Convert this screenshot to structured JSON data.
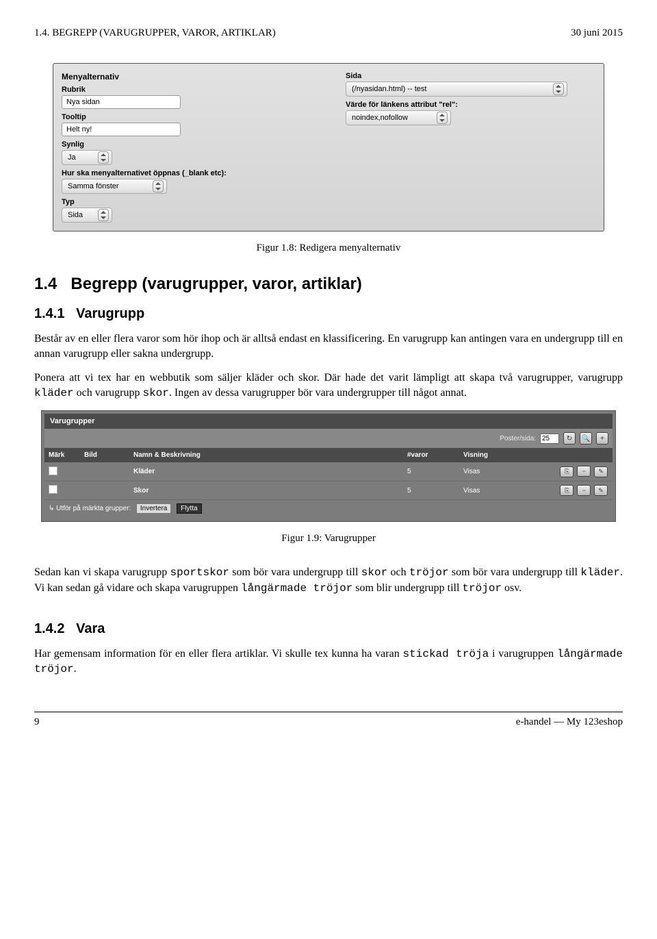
{
  "header": {
    "left": "1.4. BEGREPP (VARUGRUPPER, VAROR, ARTIKLAR)",
    "right": "30 juni 2015"
  },
  "fig1": {
    "title": "Menyalternativ",
    "labels": {
      "rubrik": "Rubrik",
      "tooltip": "Tooltip",
      "synlig": "Synlig",
      "open": "Hur ska menyalternativet öppnas (_blank etc):",
      "typ": "Typ",
      "sida": "Sida",
      "rel": "Värde för länkens attribut \"rel\":"
    },
    "values": {
      "rubrik": "Nya sidan",
      "tooltip": "Helt ny!",
      "synlig": "Ja",
      "open": "Samma fönster",
      "typ": "Sida",
      "sida": "(/nyasidan.html) -- test",
      "rel": "noindex,nofollow"
    },
    "caption": "Figur 1.8: Redigera menyalternativ"
  },
  "sec14": {
    "num": "1.4",
    "title": "Begrepp (varugrupper, varor, artiklar)"
  },
  "sec141": {
    "num": "1.4.1",
    "title": "Varugrupp",
    "p1a": "Består av en eller flera varor som hör ihop och är alltså endast en klassificering. En varugrupp kan antingen vara en undergrupp till en annan varugrupp eller sakna undergrupp.",
    "p2a": "Ponera att vi tex har en webbutik som säljer kläder och skor. Där hade det varit lämpligt att skapa två varugrupper, varugrupp ",
    "p2b": " och varugrupp ",
    "p2c": ". Ingen av dessa varugrupper bör vara undergrupper till något annat.",
    "tt_klader": "kläder",
    "tt_skor": "skor"
  },
  "fig2": {
    "title": "Varugrupper",
    "poster_label": "Poster/sida:",
    "poster_value": "25",
    "cols": {
      "mark": "Märk",
      "bild": "Bild",
      "namn": "Namn & Beskrivning",
      "varor": "#varor",
      "visning": "Visning"
    },
    "rows": [
      {
        "namn": "Kläder",
        "varor": "5",
        "visning": "Visas"
      },
      {
        "namn": "Skor",
        "varor": "5",
        "visning": "Visas"
      }
    ],
    "footer_label": "Utför på märkta grupper:",
    "invert_btn": "Invertera",
    "move_btn": "Flytta",
    "caption": "Figur 1.9: Varugrupper"
  },
  "post_fig2": {
    "p1a": "Sedan kan vi skapa varugrupp ",
    "tt1": "sportskor",
    "p1b": " som bör vara undergrupp till ",
    "tt2": "skor",
    "p1c": " och ",
    "tt3": "tröjor",
    "p1d": " som bör vara undergrupp till ",
    "tt4": "kläder",
    "p1e": ". Vi kan sedan gå vidare och skapa varugruppen ",
    "tt5": "långärmade tröjor",
    "p1f": " som blir undergrupp till ",
    "tt6": "tröjor",
    "p1g": " osv."
  },
  "sec142": {
    "num": "1.4.2",
    "title": "Vara",
    "p1a": "Har gemensam information för en eller flera artiklar. Vi skulle tex kunna ha varan ",
    "tt1": "stickad tröja",
    "p1b": " i varugruppen ",
    "tt2": "långärmade tröjor",
    "p1c": "."
  },
  "footer": {
    "left": "9",
    "right": "e-handel — My 123eshop"
  }
}
